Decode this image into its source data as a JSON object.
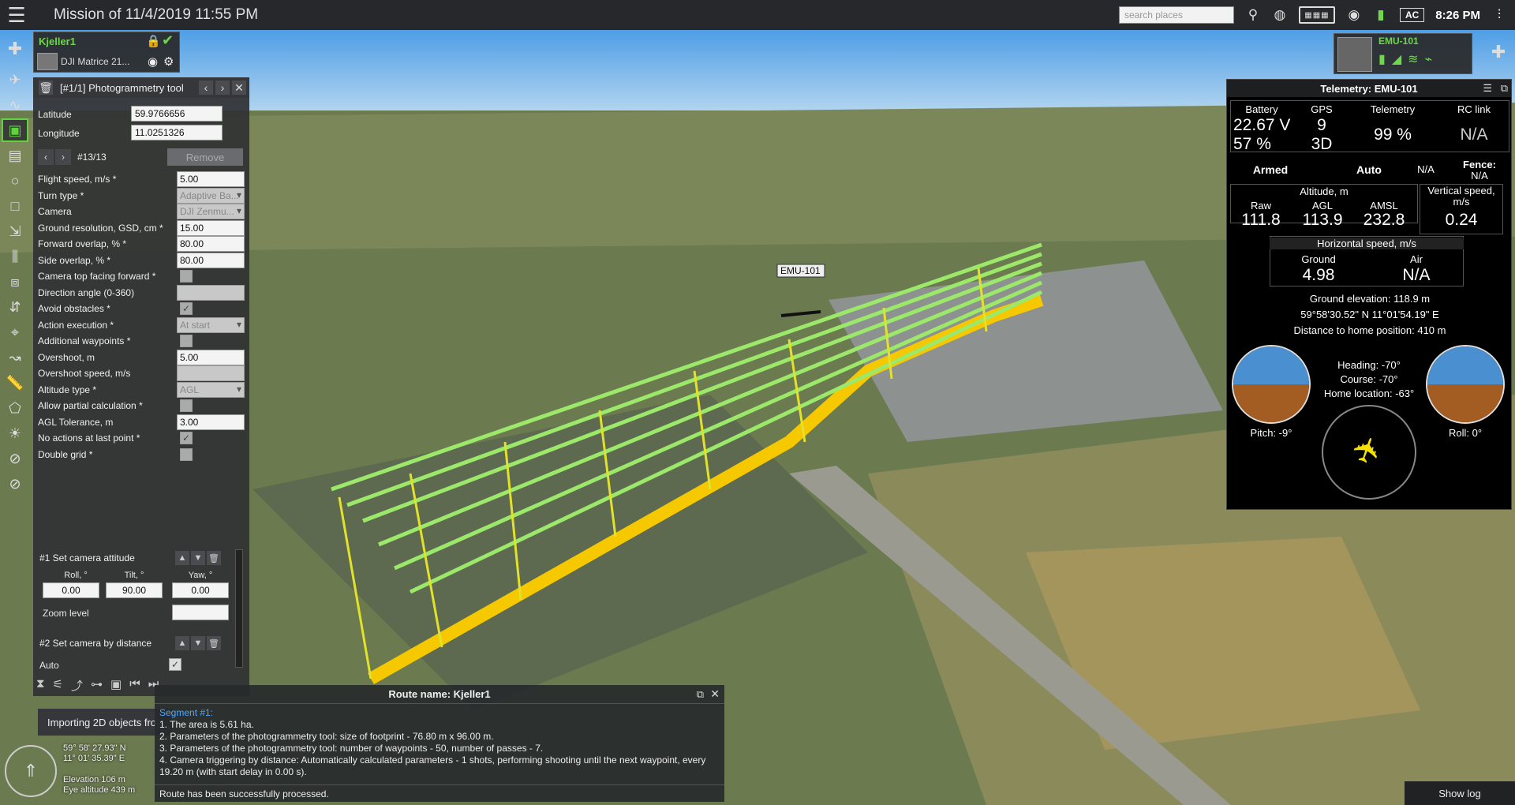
{
  "window": {
    "title": "Mission of 11/4/2019 11:55 PM",
    "clock": "8:26 PM",
    "search_placeholder": "search places",
    "ac_label": "AC"
  },
  "vehicle": {
    "name": "Kjeller1",
    "model": "DJI Matrice 21..."
  },
  "panel": {
    "title": "[#1/1] Photogrammetry tool",
    "latitude_label": "Latitude",
    "latitude": "59.9766656",
    "longitude_label": "Longitude",
    "longitude": "11.0251326",
    "point_index": "#13/13",
    "remove_label": "Remove",
    "rows": [
      {
        "label": "Flight speed, m/s *",
        "value": "5.00"
      },
      {
        "label": "Turn type *",
        "value": "Adaptive Ba..."
      },
      {
        "label": "Camera",
        "value": "DJI Zenmu..."
      },
      {
        "label": "Ground resolution, GSD, cm *",
        "value": "15.00"
      },
      {
        "label": "Forward overlap, % *",
        "value": "80.00"
      },
      {
        "label": "Side overlap, % *",
        "value": "80.00"
      },
      {
        "label": "Camera top facing forward *",
        "value": ""
      },
      {
        "label": "Direction angle (0-360)",
        "value": ""
      },
      {
        "label": "Avoid obstacles *",
        "value": ""
      },
      {
        "label": "Action execution *",
        "value": "At start"
      },
      {
        "label": "Additional waypoints *",
        "value": ""
      },
      {
        "label": "Overshoot, m",
        "value": "5.00"
      },
      {
        "label": "Overshoot speed, m/s",
        "value": ""
      },
      {
        "label": "Altitude type *",
        "value": "AGL"
      },
      {
        "label": "Allow partial calculation *",
        "value": ""
      },
      {
        "label": "AGL Tolerance, m",
        "value": "3.00"
      },
      {
        "label": "No actions at last point *",
        "value": ""
      },
      {
        "label": "Double grid *",
        "value": ""
      }
    ],
    "action1": {
      "title": "#1 Set camera attitude",
      "roll_label": "Roll, °",
      "tilt_label": "Tilt, °",
      "yaw_label": "Yaw, °",
      "roll": "0.00",
      "tilt": "90.00",
      "yaw": "0.00",
      "zoom_label": "Zoom level"
    },
    "action2": {
      "title": "#2 Set camera by distance",
      "auto_label": "Auto"
    }
  },
  "import_text": "Importing 2D objects fro",
  "coords": {
    "lat": "59° 58' 27.93\" N",
    "lon": "11° 01' 35.39\" E",
    "elevation": "Elevation 106 m",
    "eye": "Eye altitude 439 m"
  },
  "route": {
    "title": "Route name: Kjeller1",
    "segment": "Segment #1:",
    "lines": [
      "1. The area is 5.61 ha.",
      "2. Parameters of the photogrammetry tool: size of footprint - 76.80 m x 96.00 m.",
      "3. Parameters of the photogrammetry tool: number of waypoints - 50, number of passes - 7.",
      "4. Camera triggering by distance: Automatically calculated parameters - 1 shots, performing shooting until the next waypoint, every 19.20 m (with start delay in 0.00 s)."
    ],
    "status": "Route has been successfully processed."
  },
  "show_log": "Show log",
  "map_labels": {
    "drone": "EMU-101"
  },
  "emu": {
    "name": "EMU-101"
  },
  "telemetry": {
    "title": "Telemetry: EMU-101",
    "battery_label": "Battery",
    "battery_v": "22.67 V",
    "battery_pct": "57 %",
    "gps_label": "GPS",
    "gps_sats": "9",
    "gps_fix": "3D",
    "tel_label": "Telemetry",
    "tel_value": "99 %",
    "rc_label": "RC link",
    "rc_value": "N/A",
    "armed": "Armed",
    "mode": "Auto",
    "na": "N/A",
    "fence": "Fence:",
    "fence_val": "N/A",
    "alt_label": "Altitude, m",
    "raw_label": "Raw",
    "agl_label": "AGL",
    "amsl_label": "AMSL",
    "raw": "111.8",
    "agl": "113.9",
    "amsl": "232.8",
    "vs_label": "Vertical speed, m/s",
    "vs": "0.24",
    "hs_label": "Horizontal speed, m/s",
    "ground_label": "Ground",
    "air_label": "Air",
    "ground": "4.98",
    "air": "N/A",
    "ground_elev": "Ground elevation: 118.9 m",
    "position": "59°58'30.52\" N  11°01'54.19\" E",
    "home_dist": "Distance to home position: 410 m",
    "heading": "Heading: -70°",
    "course": "Course: -70°",
    "home_loc": "Home location: -63°",
    "pitch": "Pitch: -9°",
    "roll": "Roll: 0°"
  }
}
